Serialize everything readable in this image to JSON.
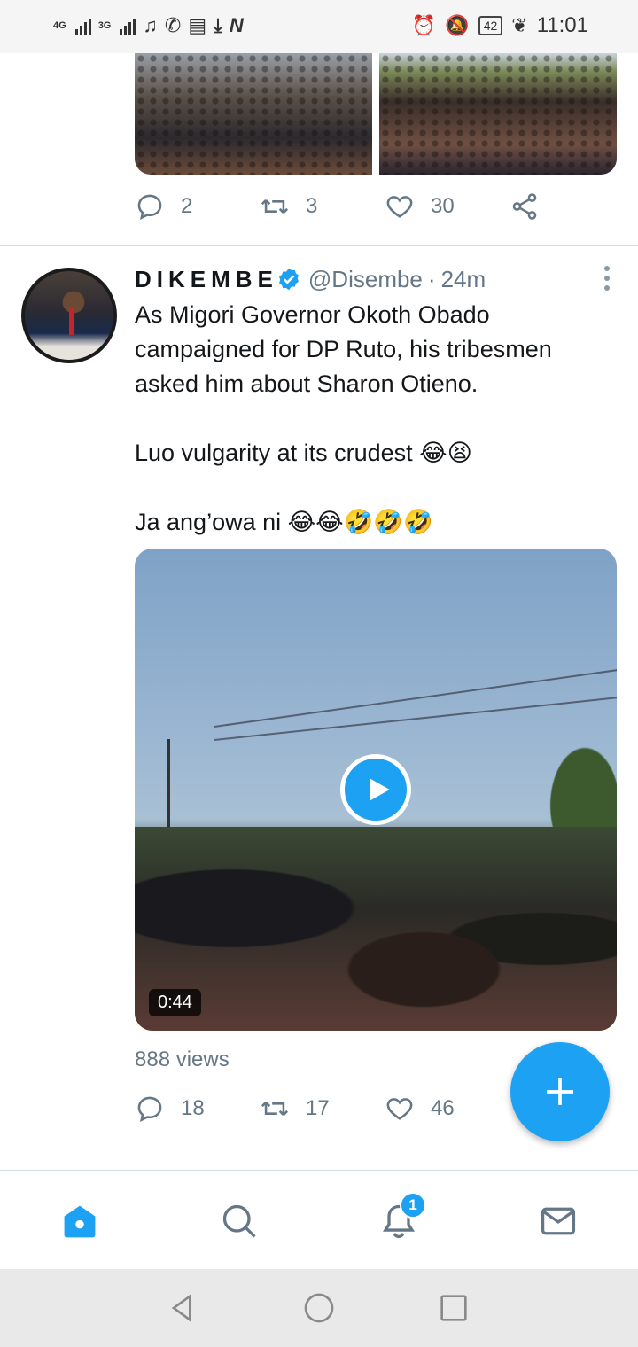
{
  "status_bar": {
    "network_1": "4G",
    "network_2": "3G",
    "battery": "42",
    "time": "11:01",
    "icons": [
      "signal-icon",
      "music-icon",
      "whatsapp-icon",
      "news-icon",
      "download-icon",
      "n-app-icon",
      "alarm-icon",
      "mute-icon",
      "battery-icon",
      "leaf-icon"
    ]
  },
  "previous_tweet": {
    "replies": "2",
    "retweets": "3",
    "likes": "30"
  },
  "tweet": {
    "author_name": "DIKEMBE",
    "handle": "@Disembe",
    "separator": "·",
    "time_ago": "24m",
    "text_line_1": "As Migori Governor Okoth Obado campaigned for DP Ruto, his tribesmen asked him about Sharon Otieno.",
    "text_line_2": "Luo vulgarity at its crudest 😂😫",
    "text_line_3": "Ja ang’owa ni 😂😂🤣🤣🤣",
    "video_duration": "0:44",
    "views": "888 views",
    "replies": "18",
    "retweets": "17",
    "likes": "46"
  },
  "bottom_nav": {
    "notification_count": "1",
    "items": [
      "home",
      "search",
      "notifications",
      "messages"
    ]
  },
  "colors": {
    "accent": "#1da1f2",
    "secondary_text": "#657786",
    "primary_text": "#14171a"
  }
}
